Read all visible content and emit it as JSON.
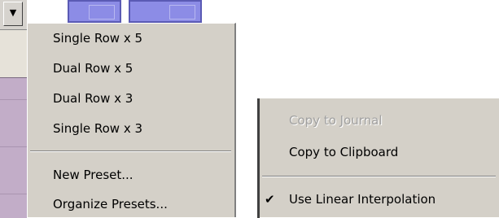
{
  "left_menu": {
    "dropdown_glyph": "▼",
    "items": [
      {
        "label": "Single Row x 5"
      },
      {
        "label": "Dual Row x 5"
      },
      {
        "label": "Dual Row x 3"
      },
      {
        "label": "Single Row x 3"
      },
      {
        "label": "New Preset..."
      },
      {
        "label": "Organize Presets..."
      }
    ]
  },
  "right_menu": {
    "items": [
      {
        "label": "Copy to Journal",
        "enabled": false
      },
      {
        "label": "Copy to Clipboard",
        "enabled": true
      },
      {
        "label": "Use Linear Interpolation",
        "enabled": true,
        "checked": true
      }
    ],
    "check_glyph": "✔"
  }
}
